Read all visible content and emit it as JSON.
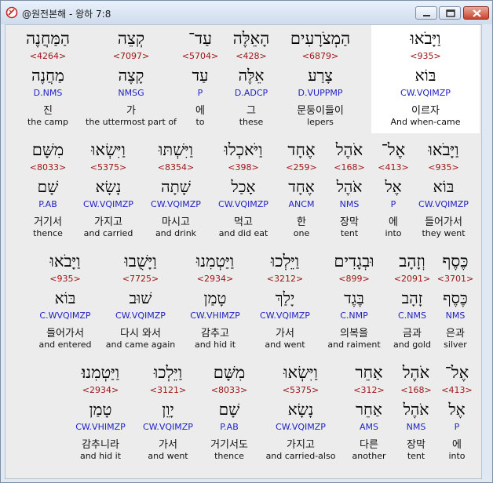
{
  "window": {
    "title": "@원전본해 - 왕하 7:8"
  },
  "rows": [
    {
      "words": [
        {
          "heb": "וַיָּבֹאוּ",
          "num": "<935>",
          "lex": "בּוֹא",
          "morph": "CW.VQIMZP",
          "kor": "이르자",
          "eng": "And when-came",
          "selected": true
        },
        {
          "heb": "הַמְצֹרָעִים",
          "num": "<6879>",
          "lex": "צָרַע",
          "morph": "D.VUPPMP",
          "kor": "문둥이들이",
          "eng": "lepers"
        },
        {
          "heb": "הָאֵלֶּה",
          "num": "<428>",
          "lex": "אֵלֶּה",
          "morph": "D.ADCP",
          "kor": "그",
          "eng": "these"
        },
        {
          "heb": "עַד־",
          "num": "<5704>",
          "lex": "עַד",
          "morph": "P",
          "kor": "에",
          "eng": "to"
        },
        {
          "heb": "קְצֵה",
          "num": "<7097>",
          "lex": "קָצֶה",
          "morph": "NMSG",
          "kor": "가",
          "eng": "the uttermost part of"
        },
        {
          "heb": "הַמַּחֲנֶה",
          "num": "<4264>",
          "lex": "מַחֲנֶה",
          "morph": "D.NMS",
          "kor": "진",
          "eng": "the camp"
        }
      ]
    },
    {
      "words": [
        {
          "heb": "וַיָּבֹאוּ",
          "num": "<935>",
          "lex": "בּוֹא",
          "morph": "CW.VQIMZP",
          "kor": "들어가서",
          "eng": "they went"
        },
        {
          "heb": "אֶל־",
          "num": "<413>",
          "lex": "אֶל",
          "morph": "P",
          "kor": "에",
          "eng": "into"
        },
        {
          "heb": "אֹהֶל",
          "num": "<168>",
          "lex": "אֹהֶל",
          "morph": "NMS",
          "kor": "장막",
          "eng": "tent"
        },
        {
          "heb": "אֶחָד",
          "num": "<259>",
          "lex": "אֶחָד",
          "morph": "ANCM",
          "kor": "한",
          "eng": "one"
        },
        {
          "heb": "וַיֹּאכְלוּ",
          "num": "<398>",
          "lex": "אָכַל",
          "morph": "CW.VQIMZP",
          "kor": "먹고",
          "eng": "and did eat"
        },
        {
          "heb": "וַיִּשְׁתּוּ",
          "num": "<8354>",
          "lex": "שָׁתָה",
          "morph": "CW.VQIMZP",
          "kor": "마시고",
          "eng": "and drink"
        },
        {
          "heb": "וַיִּשְׂאוּ",
          "num": "<5375>",
          "lex": "נָשָׂא",
          "morph": "CW.VQIMZP",
          "kor": "가지고",
          "eng": "and carried"
        },
        {
          "heb": "מִשָּׁם",
          "num": "<8033>",
          "lex": "שָׁם",
          "morph": "P.AB",
          "kor": "거기서",
          "eng": "thence"
        }
      ]
    },
    {
      "words": [
        {
          "heb": "כֶּסֶף",
          "num": "<3701>",
          "lex": "כֶּסֶף",
          "morph": "NMS",
          "kor": "은과",
          "eng": "silver"
        },
        {
          "heb": "וְזָהָב",
          "num": "<2091>",
          "lex": "זָהָב",
          "morph": "C.NMS",
          "kor": "금과",
          "eng": "and gold"
        },
        {
          "heb": "וּבְגָדִים",
          "num": "<899>",
          "lex": "בֶּגֶד",
          "morph": "C.NMP",
          "kor": "의복을",
          "eng": "and raiment"
        },
        {
          "heb": "וַיֵּלְכוּ",
          "num": "<3212>",
          "lex": "יָלַךְ",
          "morph": "CW.VQIMZP",
          "kor": "가서",
          "eng": "and went"
        },
        {
          "heb": "וַיַּטְמִנוּ",
          "num": "<2934>",
          "lex": "טָמַן",
          "morph": "CW.VHIMZP",
          "kor": "감추고",
          "eng": "and hid it"
        },
        {
          "heb": "וַיָּשֻׁבוּ",
          "num": "<7725>",
          "lex": "שׁוּב",
          "morph": "CW.VQIMZP",
          "kor": "다시 와서",
          "eng": "and came again"
        },
        {
          "heb": "וַיָּבֹאוּ",
          "num": "<935>",
          "lex": "בּוֹא",
          "morph": "C.WVQIMZP",
          "kor": "들어가서",
          "eng": "and entered"
        }
      ]
    },
    {
      "words": [
        {
          "heb": "אֶל־",
          "num": "<413>",
          "lex": "אֶל",
          "morph": "P",
          "kor": "에",
          "eng": "into"
        },
        {
          "heb": "אֹהֶל",
          "num": "<168>",
          "lex": "אֹהֶל",
          "morph": "NMS",
          "kor": "장막",
          "eng": "tent"
        },
        {
          "heb": "אַחֵר",
          "num": "<312>",
          "lex": "אַחֵר",
          "morph": "AMS",
          "kor": "다른",
          "eng": "another"
        },
        {
          "heb": "וַיִּשְׂאוּ",
          "num": "<5375>",
          "lex": "נָשָׂא",
          "morph": "CW.VQIMZP",
          "kor": "가지고",
          "eng": "and carried-also"
        },
        {
          "heb": "מִשָּׁם",
          "num": "<8033>",
          "lex": "שָׁם",
          "morph": "P.AB",
          "kor": "거기서도",
          "eng": "thence"
        },
        {
          "heb": "וַיֵּלְכוּ",
          "num": "<3121>",
          "lex": "יָוֵן",
          "morph": "CW.VQIMZP",
          "kor": "가서",
          "eng": "and went"
        },
        {
          "heb": "וַיַּטְמִנוּ׃",
          "num": "<2934>",
          "lex": "טָמַן",
          "morph": "CW.VHIMZP",
          "kor": "감추니라",
          "eng": "and hid it"
        }
      ]
    }
  ],
  "icons": {
    "app": "bible-app-icon",
    "minimize": "minimize-icon",
    "maximize": "maximize-icon",
    "close": "close-icon"
  },
  "colors": {
    "strong_number": "#9b1414",
    "morphology": "#2222c4",
    "selected_background": "#ffffff"
  }
}
